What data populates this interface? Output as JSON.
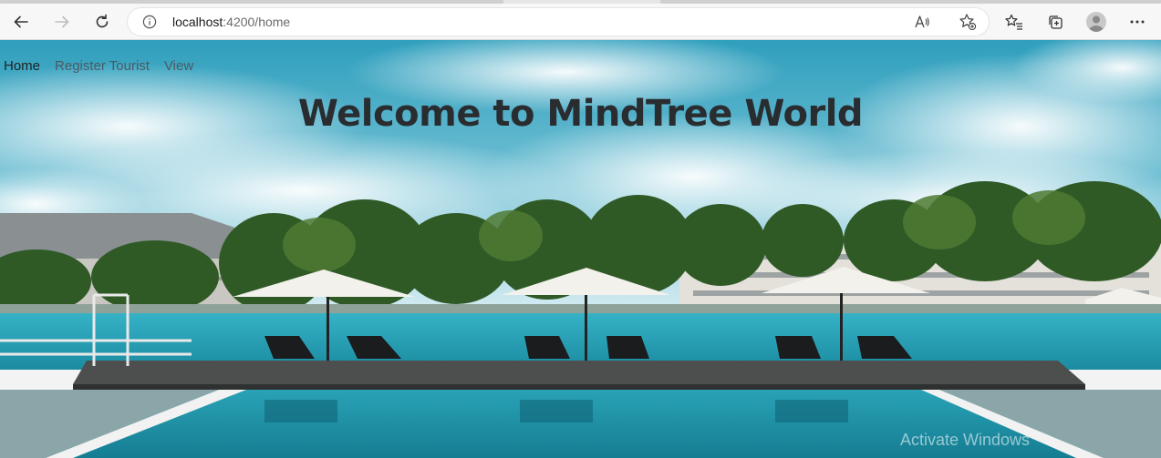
{
  "browser": {
    "url_host": "localhost",
    "url_path": ":4200/home",
    "icons": {
      "back": "back-arrow-icon",
      "forward": "forward-arrow-icon",
      "refresh": "refresh-icon",
      "site_info": "info-icon",
      "read_aloud": "read-aloud-icon",
      "add_favorite": "star-plus-icon",
      "favorites": "favorites-icon",
      "collections": "collections-icon",
      "profile": "avatar",
      "menu": "more-icon"
    }
  },
  "page": {
    "nav": {
      "items": [
        {
          "label": "Home",
          "active": true
        },
        {
          "label": "Register Tourist",
          "active": false
        },
        {
          "label": "View",
          "active": false
        }
      ]
    },
    "heading": "Welcome to MindTree World",
    "background": "resort pool with umbrellas under blue cloudy sky"
  },
  "os_watermark": {
    "line1": "Activate Windows"
  },
  "colors": {
    "sky": "#3aa7c4",
    "pool": "#1b8aa0",
    "heading": "#2a2d30",
    "nav_text": "#4c5a63"
  }
}
